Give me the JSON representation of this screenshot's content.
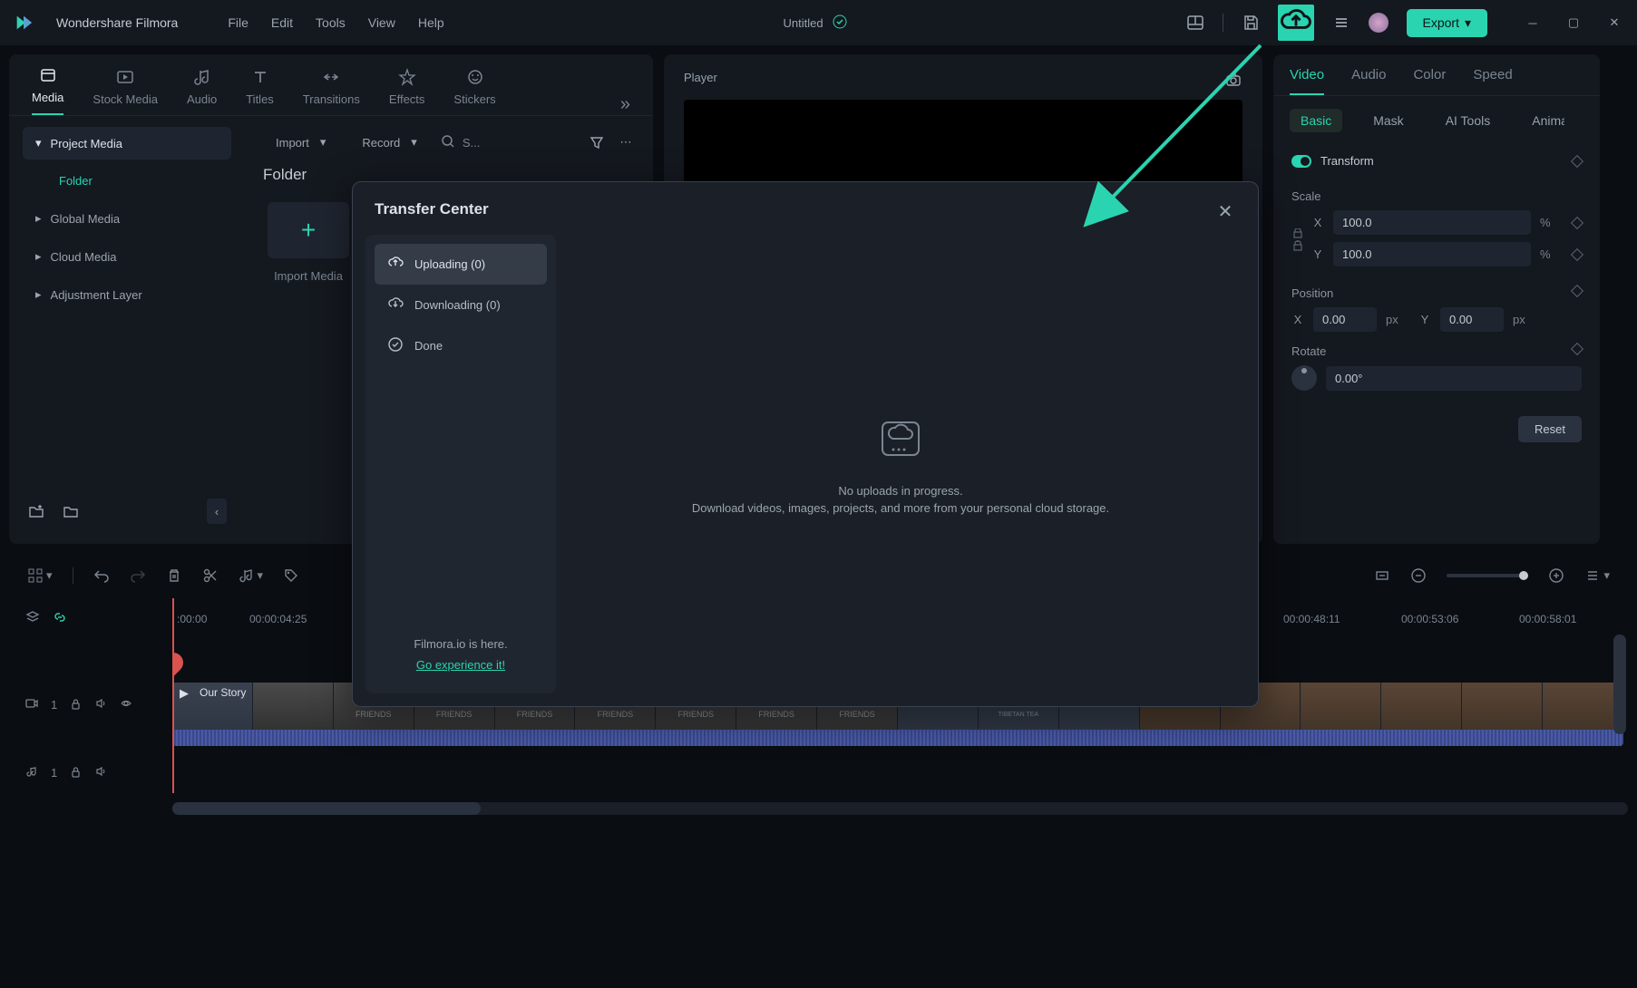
{
  "titlebar": {
    "app_name": "Wondershare Filmora",
    "menus": [
      "File",
      "Edit",
      "Tools",
      "View",
      "Help"
    ],
    "document_title": "Untitled",
    "export_label": "Export"
  },
  "tabs": {
    "items": [
      "Media",
      "Stock Media",
      "Audio",
      "Titles",
      "Transitions",
      "Effects",
      "Stickers"
    ],
    "active": "Media"
  },
  "media_sidebar": {
    "project_media": "Project Media",
    "folder": "Folder",
    "global_media": "Global Media",
    "cloud_media": "Cloud Media",
    "adjustment_layer": "Adjustment Layer"
  },
  "media_toolbar": {
    "import": "Import",
    "record": "Record",
    "search_placeholder": "S..."
  },
  "media_content": {
    "folder_title": "Folder",
    "import_label": "Import Media"
  },
  "player": {
    "title": "Player"
  },
  "props": {
    "tabs": [
      "Video",
      "Audio",
      "Color",
      "Speed"
    ],
    "subtabs": [
      "Basic",
      "Mask",
      "AI Tools",
      "Animation"
    ],
    "transform": "Transform",
    "scale": "Scale",
    "scale_x": "100.0",
    "scale_y": "100.0",
    "position": "Position",
    "pos_x": "0.00",
    "pos_y": "0.00",
    "rotate": "Rotate",
    "rotate_val": "0.00°",
    "reset": "Reset",
    "pct": "%",
    "px": "px",
    "x": "X",
    "y": "Y"
  },
  "timeline": {
    "ruler": [
      ":00:00",
      "00:00:04:25",
      "00:00:48:11",
      "00:00:53:06",
      "00:00:58:01"
    ],
    "clip_label": "Our Story",
    "track_video": "1",
    "track_audio": "1",
    "thumb_label": "FRIENDS",
    "thumb_tea": "TIBETAN TEA"
  },
  "modal": {
    "title": "Transfer Center",
    "uploading": "Uploading (0)",
    "downloading": "Downloading (0)",
    "done": "Done",
    "empty_line1": "No uploads in progress.",
    "empty_line2": "Download videos, images, projects, and more from your personal cloud storage.",
    "filmora_io": "Filmora.io is here.",
    "experience": "Go experience it!"
  }
}
